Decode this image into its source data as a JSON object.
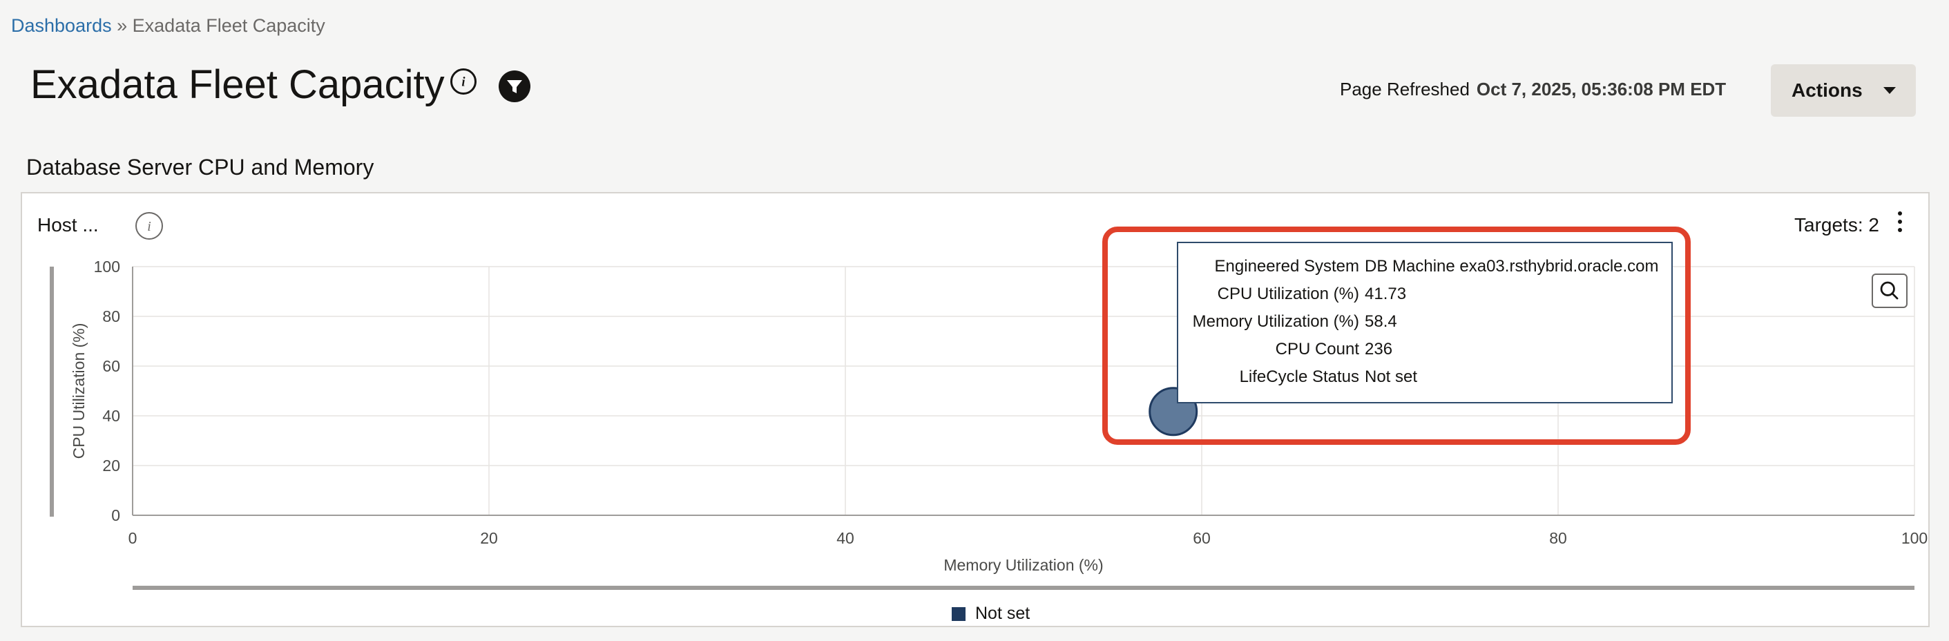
{
  "breadcrumb": {
    "root": "Dashboards",
    "separator": "»",
    "current": "Exadata Fleet Capacity"
  },
  "header": {
    "title": "Exadata Fleet Capacity",
    "refresh_label": "Page Refreshed",
    "refresh_value": "Oct 7, 2025, 05:36:08 PM EDT",
    "actions_label": "Actions"
  },
  "section": {
    "title": "Database Server CPU and Memory"
  },
  "card": {
    "host_label": "Host ...",
    "targets_label": "Targets: 2"
  },
  "tooltip": {
    "rows": [
      {
        "key": "Engineered System",
        "value": "DB Machine exa03.rsthybrid.oracle.com"
      },
      {
        "key": "CPU Utilization (%)",
        "value": "41.73"
      },
      {
        "key": "Memory Utilization (%)",
        "value": "58.4"
      },
      {
        "key": "CPU Count",
        "value": "236"
      },
      {
        "key": "LifeCycle Status",
        "value": "Not set"
      }
    ]
  },
  "colors": {
    "link": "#2b6ea8",
    "accent_red": "#e0412b",
    "series": "#1f3a5f",
    "bubble": "#5f7a9a"
  },
  "icons": [
    "info-icon",
    "filter-icon",
    "caret-down-icon",
    "kebab-icon",
    "search-icon"
  ],
  "chart_data": {
    "type": "scatter",
    "xlabel": "Memory Utilization (%)",
    "ylabel": "CPU Utilization (%)",
    "xlim": [
      0,
      100
    ],
    "ylim": [
      0,
      100
    ],
    "xticks": [
      0,
      20,
      40,
      60,
      80,
      100
    ],
    "yticks": [
      0,
      20,
      40,
      60,
      80,
      100
    ],
    "grid": true,
    "legend_position": "bottom",
    "series": [
      {
        "name": "Not set",
        "points": [
          {
            "x": 58.4,
            "y": 41.73,
            "size": 236
          }
        ]
      }
    ]
  }
}
